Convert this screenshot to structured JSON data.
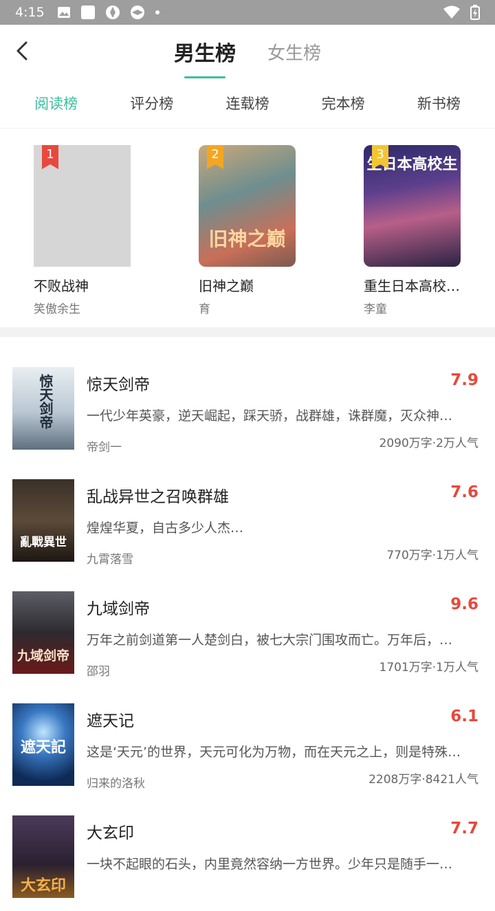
{
  "status_bar": {
    "time": "4:15"
  },
  "header": {
    "tabs": [
      "男生榜",
      "女生榜"
    ],
    "active_tab": 0,
    "accent_color": "#3bbf9c"
  },
  "rank_tabs": [
    "阅读榜",
    "评分榜",
    "连载榜",
    "完本榜",
    "新书榜"
  ],
  "top3": [
    {
      "rank": "1",
      "title": "不败战神",
      "author": "笑傲余生",
      "cover_text": ""
    },
    {
      "rank": "2",
      "title": "旧神之巅",
      "author": "育",
      "cover_text": "旧神之巅"
    },
    {
      "rank": "3",
      "title": "重生日本高校…",
      "author": "李童",
      "cover_text": "生日本高校生"
    }
  ],
  "list": [
    {
      "title": "惊天剑帝",
      "score": "7.9",
      "desc": "一代少年英豪，逆天崛起，踩天骄，战群雄，诛群魔，灭众神…",
      "author": "帝剑一",
      "meta": "2090万字·2万人气",
      "cover_text": "惊天剑帝"
    },
    {
      "title": "乱战异世之召唤群雄",
      "score": "7.6",
      "desc": "煌煌华夏，自古多少人杰…",
      "author": "九霄落雪",
      "meta": "770万字·1万人气",
      "cover_text": "亂戰異世"
    },
    {
      "title": "九域剑帝",
      "score": "9.6",
      "desc": "万年之前剑道第一人楚剑白，被七大宗门围攻而亡。万年后，…",
      "author": "邵羽",
      "meta": "1701万字·1万人气",
      "cover_text": "九域剑帝"
    },
    {
      "title": "遮天记",
      "score": "6.1",
      "desc": "这是‘天元’的世界，天元可化为万物，而在天元之上，则是特殊…",
      "author": "归来的洛秋",
      "meta": "2208万字·8421人气",
      "cover_text": "遮天記"
    },
    {
      "title": "大玄印",
      "score": "7.7",
      "desc": "一块不起眼的石头，内里竟然容纳一方世界。少年只是随手一…",
      "author": "",
      "meta": "",
      "cover_text": "大玄印"
    }
  ]
}
